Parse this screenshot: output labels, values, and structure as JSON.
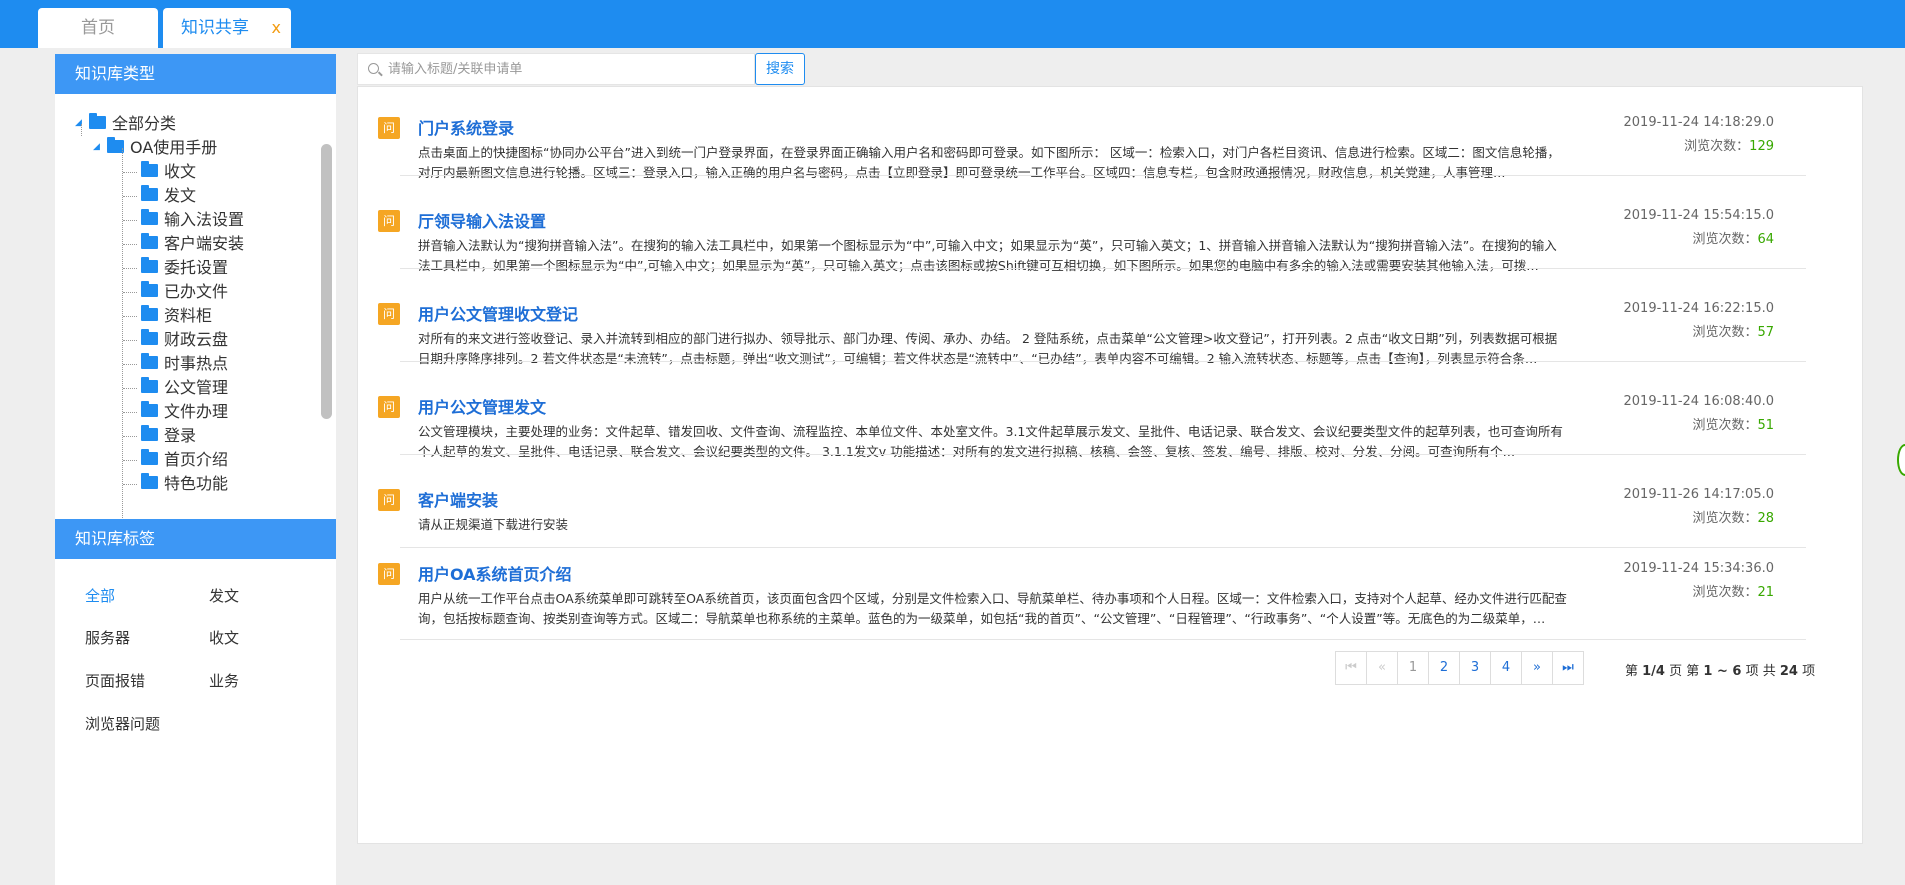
{
  "tabs": {
    "home": "首页",
    "active": "知识共享",
    "close": "x"
  },
  "sidebar": {
    "type_title": "知识库类型",
    "tree": {
      "root": "全部分类",
      "group": "OA使用手册",
      "items": [
        "收文",
        "发文",
        "输入法设置",
        "客户端安装",
        "委托设置",
        "已办文件",
        "资料柜",
        "财政云盘",
        "时事热点",
        "公文管理",
        "文件办理",
        "登录",
        "首页介绍",
        "特色功能"
      ]
    },
    "tags_title": "知识库标签",
    "tags": [
      "全部",
      "发文",
      "服务器",
      "收文",
      "页面报错",
      "业务",
      "浏览器问题"
    ]
  },
  "search": {
    "placeholder": "请输入标题/关联申请单",
    "button": "搜索"
  },
  "list": {
    "q_label": "问",
    "views_label": "浏览次数：",
    "items": [
      {
        "title": "门户系统登录",
        "desc": "点击桌面上的快捷图标“协同办公平台”进入到统一门户登录界面，在登录界面正确输入用户名和密码即可登录。如下图所示： 区域一：检索入口，对门户各栏目资讯、信息进行检索。区域二：图文信息轮播，对厅内最新图文信息进行轮播。区域三：登录入口，输入正确的用户名与密码，点击【立即登录】即可登录统一工作平台。区域四：信息专栏，包含财政通报情况，财政信息，机关党建，人事管理…",
        "date": "2019-11-24 14:18:29.0",
        "views": "129"
      },
      {
        "title": "厅领导输入法设置",
        "desc": "拼音输入法默认为“搜狗拼音输入法”。在搜狗的输入法工具栏中，如果第一个图标显示为“中”,可输入中文；如果显示为“英”，只可输入英文；1、拼音输入拼音输入法默认为“搜狗拼音输入法”。在搜狗的输入法工具栏中，如果第一个图标显示为“中”,可输入中文；如果显示为“英”，只可输入英文；点击该图标或按Shift键可互相切换，如下图所示。如果您的电脑中有多余的输入法或需要安装其他输入法，可拨…",
        "date": "2019-11-24 15:54:15.0",
        "views": "64"
      },
      {
        "title": "用户公文管理收文登记",
        "desc": "对所有的来文进行签收登记、录入并流转到相应的部门进行拟办、领导批示、部门办理、传阅、承办、办结。 2 登陆系统，点击菜单“公文管理>收文登记”，打开列表。2 点击“收文日期”列，列表数据可根据日期升序降序排列。2 若文件状态是“未流转”，点击标题，弹出“收文测试”，可编辑；若文件状态是“流转中”、“已办结”，表单内容不可编辑。2 输入流转状态、标题等，点击【查询】，列表显示符合条…",
        "date": "2019-11-24 16:22:15.0",
        "views": "57"
      },
      {
        "title": "用户公文管理发文",
        "desc": "公文管理模块，主要处理的业务：文件起草、错发回收、文件查询、流程监控、本单位文件、本处室文件。3.1文件起草展示发文、呈批件、电话记录、联合发文、会议纪要类型文件的起草列表，也可查询所有个人起草的发文、呈批件、电话记录、联合发文、会议纪要类型的文件。 3.1.1发文v 功能描述：对所有的发文进行拟稿、核稿、会签、复核、签发、编号、排版、校对、分发、分阅。可查询所有个…",
        "date": "2019-11-24 16:08:40.0",
        "views": "51"
      },
      {
        "title": "客户端安装",
        "desc": "请从正规渠道下载进行安装",
        "date": "2019-11-26 14:17:05.0",
        "views": "28"
      },
      {
        "title": "用户OA系统首页介绍",
        "desc": "用户从统一工作平台点击OA系统菜单即可跳转至OA系统首页，该页面包含四个区域，分别是文件检索入口、导航菜单栏、待办事项和个人日程。区域一：文件检索入口，支持对个人起草、经办文件进行匹配查询，包括按标题查询、按类别查询等方式。区域二：导航菜单也称系统的主菜单。蓝色的为一级菜单，如包括“我的首页”、“公文管理”、“日程管理”、“行政事务”、“个人设置”等。无底色的为二级菜单，…",
        "date": "2019-11-24 15:34:36.0",
        "views": "21"
      }
    ]
  },
  "pager": {
    "first": "⏮",
    "prev": "«",
    "pages": [
      "1",
      "2",
      "3",
      "4"
    ],
    "next": "»",
    "last": "⏭",
    "page_prefix": "第 ",
    "page_value": "1/4",
    "page_suffix": " 页",
    "range_prefix": "第 ",
    "range_value": "1 ~ 6",
    "range_suffix": " 项",
    "total_prefix": "共 ",
    "total_value": "24",
    "total_suffix": " 项"
  }
}
